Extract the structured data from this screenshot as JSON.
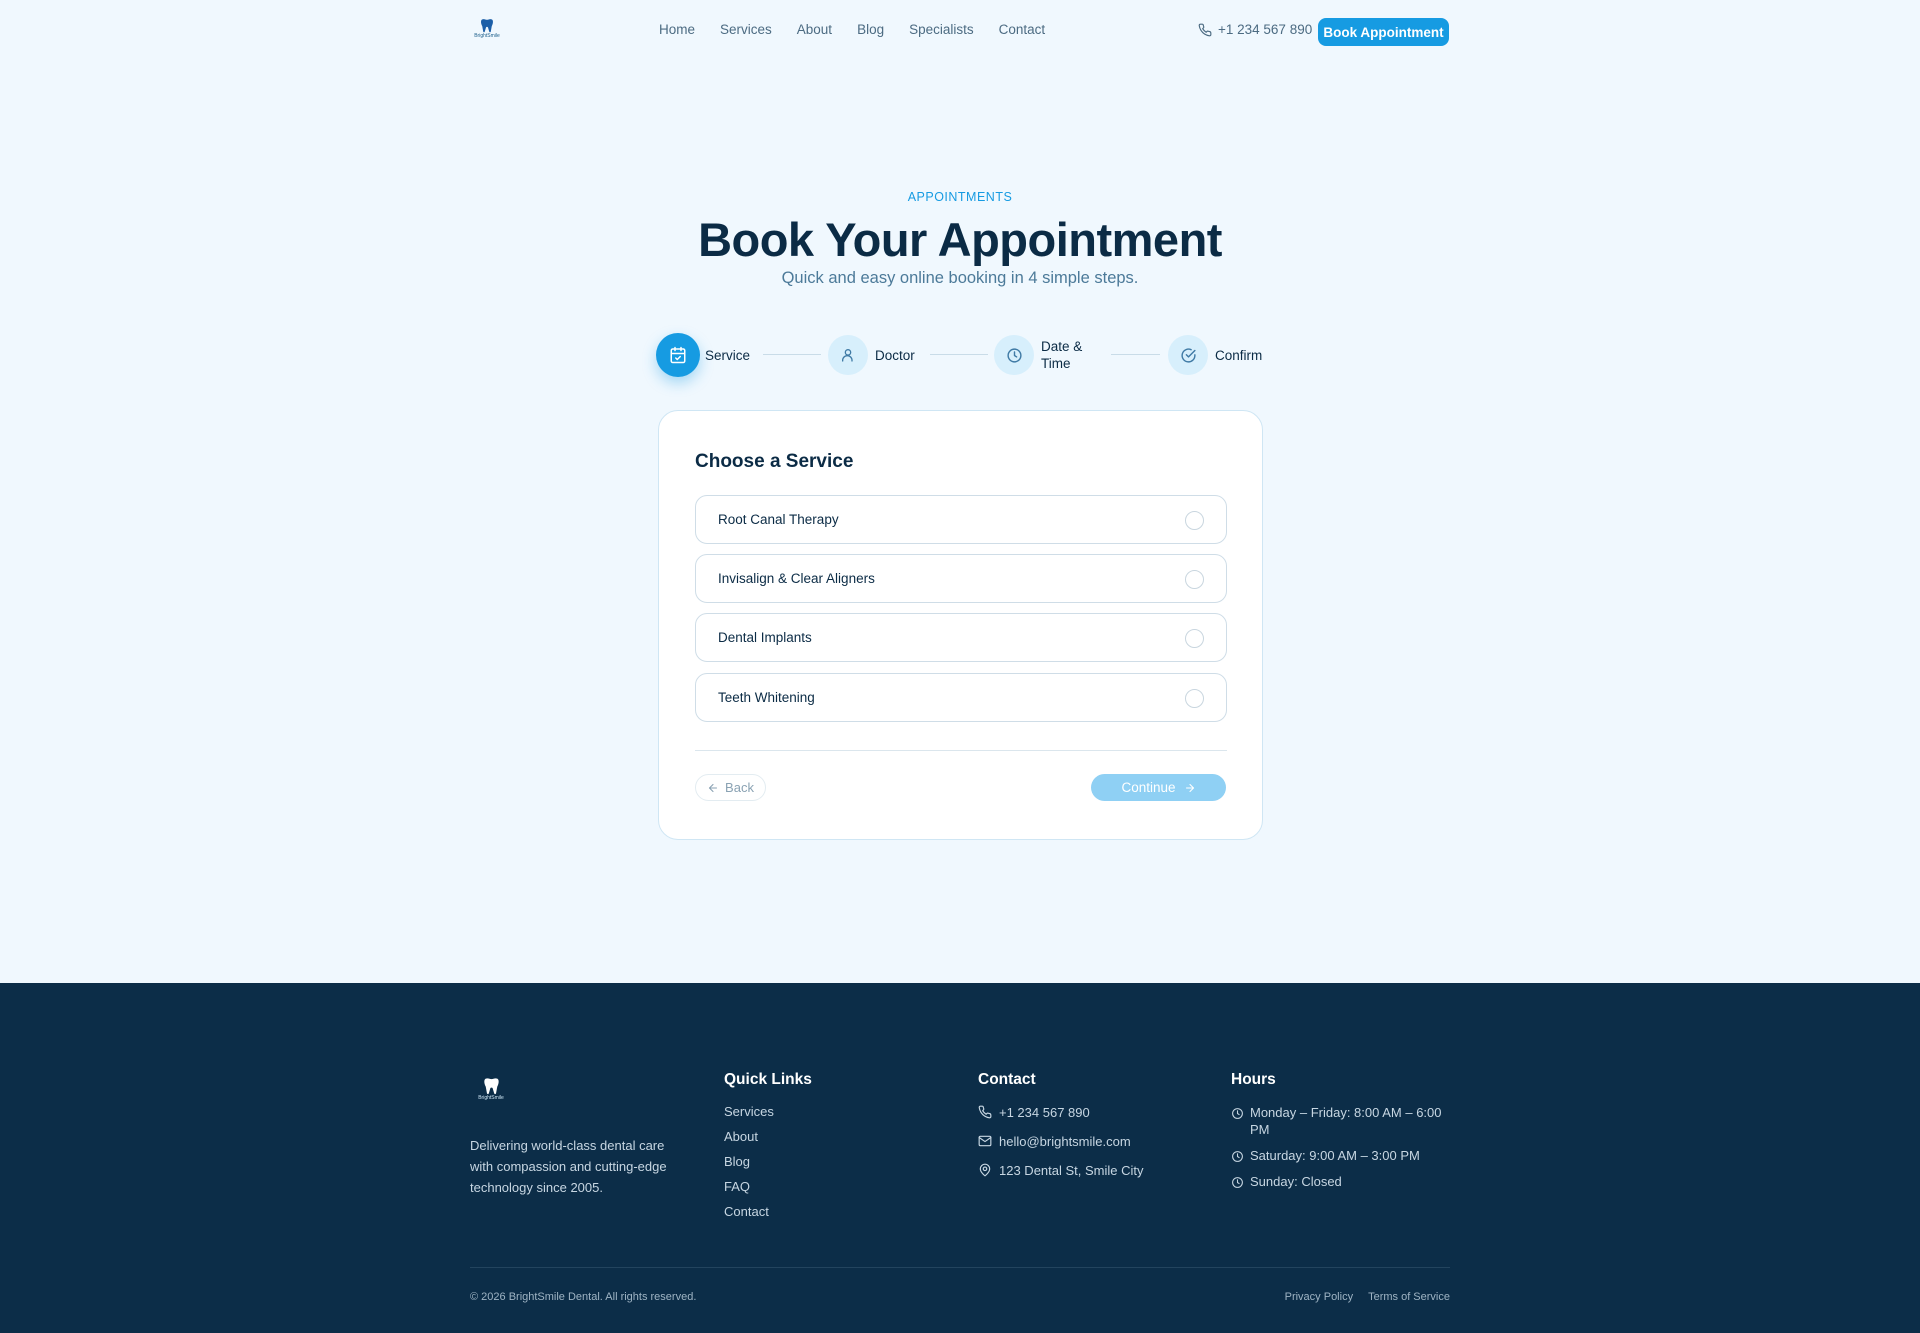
{
  "brand": {
    "name": "BrightSmile Dental",
    "logo_text": "BrightSmile"
  },
  "header": {
    "nav": [
      "Home",
      "Services",
      "About",
      "Blog",
      "Specialists",
      "Contact"
    ],
    "phone": "+1 234 567 890",
    "cta_label": "Book Appointment"
  },
  "hero": {
    "eyebrow": "APPOINTMENTS",
    "title": "Book Your Appointment",
    "subtitle": "Quick and easy online booking in 4 simple steps."
  },
  "stepper": {
    "active_step": 0,
    "steps": [
      {
        "label": "Service",
        "icon": "calendar-check-icon"
      },
      {
        "label": "Doctor",
        "icon": "user-icon"
      },
      {
        "label": "Date & Time",
        "icon": "clock-icon"
      },
      {
        "label": "Confirm",
        "icon": "check-circle-icon"
      }
    ]
  },
  "card": {
    "title": "Choose a Service",
    "options": [
      {
        "label": "Root Canal Therapy",
        "selected": false
      },
      {
        "label": "Invisalign & Clear Aligners",
        "selected": false
      },
      {
        "label": "Dental Implants",
        "selected": false
      },
      {
        "label": "Teeth Whitening",
        "selected": false
      }
    ],
    "back_label": "Back",
    "continue_label": "Continue"
  },
  "footer": {
    "description": "Delivering world-class dental care with compassion and cutting-edge technology since 2005.",
    "quick_links": {
      "heading": "Quick Links",
      "items": [
        "Services",
        "About",
        "Blog",
        "FAQ",
        "Contact"
      ]
    },
    "contact": {
      "heading": "Contact",
      "phone": "+1 234 567 890",
      "email": "hello@brightsmile.com",
      "address": "123 Dental St, Smile City"
    },
    "hours": {
      "heading": "Hours",
      "items": [
        "Monday – Friday: 8:00 AM – 6:00 PM",
        "Saturday: 9:00 AM – 3:00 PM",
        "Sunday: Closed"
      ]
    },
    "copyright": "© 2026 BrightSmile Dental. All rights reserved.",
    "legal": [
      "Privacy Policy",
      "Terms of Service"
    ]
  },
  "colors": {
    "primary": "#169be2",
    "primary_light": "#8fd0f4",
    "navy": "#0c2d48",
    "page_bg": "#f0f8fe"
  }
}
